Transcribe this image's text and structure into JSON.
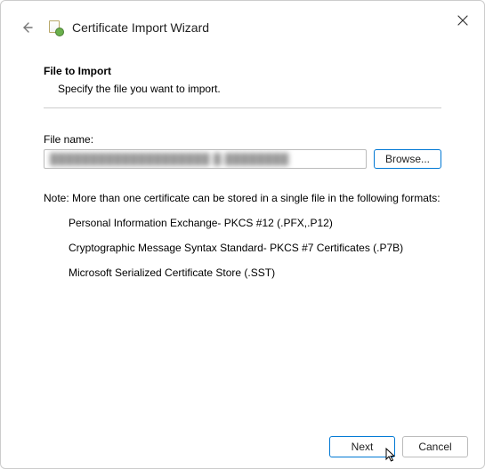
{
  "window": {
    "title": "Certificate Import Wizard"
  },
  "page": {
    "heading": "File to Import",
    "subheading": "Specify the file you want to import.",
    "file_label": "File name:",
    "file_value": "████████████████████  █.████████",
    "browse_label": "Browse...",
    "note": "Note:  More than one certificate can be stored in a single file in the following formats:",
    "formats": [
      "Personal Information Exchange- PKCS #12 (.PFX,.P12)",
      "Cryptographic Message Syntax Standard- PKCS #7 Certificates (.P7B)",
      "Microsoft Serialized Certificate Store (.SST)"
    ]
  },
  "buttons": {
    "next": "Next",
    "cancel": "Cancel"
  }
}
